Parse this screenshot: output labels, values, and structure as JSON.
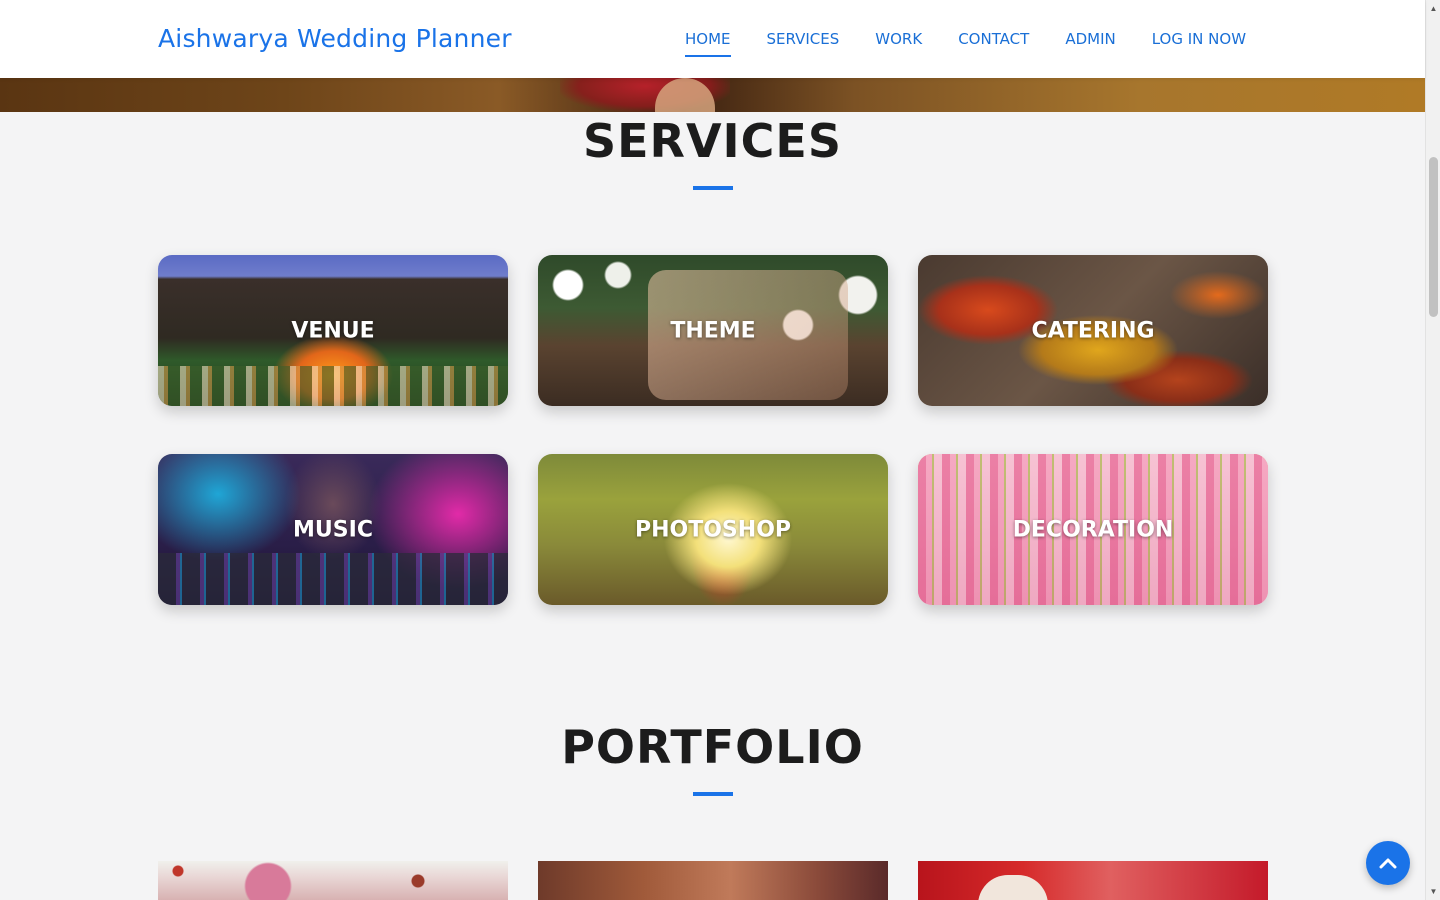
{
  "brand": {
    "name": "Aishwarya Wedding Planner"
  },
  "nav": {
    "items": [
      {
        "label": "HOME",
        "active": true
      },
      {
        "label": "SERVICES",
        "active": false
      },
      {
        "label": "WORK",
        "active": false
      },
      {
        "label": "CONTACT",
        "active": false
      },
      {
        "label": "ADMIN",
        "active": false
      },
      {
        "label": "LOG IN NOW",
        "active": false
      }
    ]
  },
  "services": {
    "title": "SERVICES",
    "cards": [
      {
        "label": "VENUE"
      },
      {
        "label": "THEME"
      },
      {
        "label": "CATERING"
      },
      {
        "label": "MUSIC"
      },
      {
        "label": "PHOTOSHOP"
      },
      {
        "label": "DECORATION"
      }
    ]
  },
  "portfolio": {
    "title": "PORTFOLIO"
  },
  "colors": {
    "accent": "#1a73e8",
    "heading": "#1c1c1c",
    "background": "#f4f4f5"
  },
  "icons": {
    "back_to_top": "chevron-up-icon",
    "scroll_up": "arrow-up-icon",
    "scroll_down": "arrow-down-icon"
  }
}
